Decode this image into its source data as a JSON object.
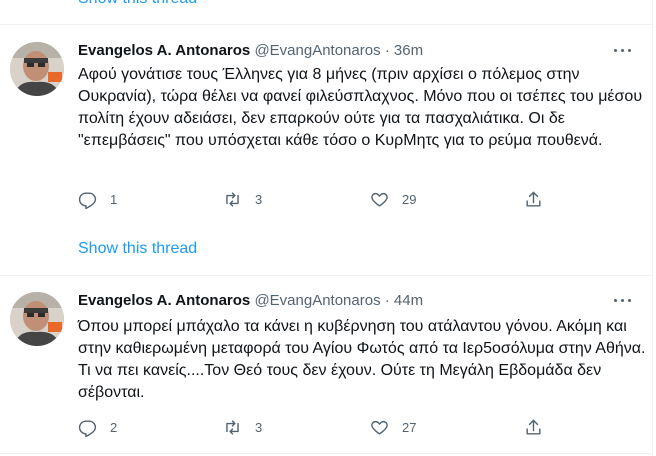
{
  "top_link": "Show this thread",
  "tweets": [
    {
      "name": "Evangelos A. Antonaros",
      "handle": "@EvangAntonaros",
      "sep": "·",
      "time": "36m",
      "text": "Αφού γονάτισε τους Έλληνες για 8 μήνες (πριν αρχίσει ο πόλεμος στην Ουκρανία), τώρα θέλει να φανεί φιλεύσπλαχνος. Μόνο που οι τσέπες του μέσου πολίτη έχουν αδειάσει, δεν επαρκούν ούτε για τα πασχαλιάτικα. Οι δε \"επεμβάσεις\" που υπόσχεται κάθε τόσο ο ΚυρΜητς για το ρεύμα πουθενά.",
      "replies": "1",
      "retweets": "3",
      "likes": "29",
      "show_thread": "Show this thread"
    },
    {
      "name": "Evangelos A. Antonaros",
      "handle": "@EvangAntonaros",
      "sep": "·",
      "time": "44m",
      "text": "Όπου μπορεί μπάχαλο τα κάνει η κυβέρνηση του ατάλαντου γόνου. Ακόμη και στην καθιερωμένη μεταφορά του Αγίου Φωτός από τα Ιερ5οσόλυμα στην Αθήνα. Τι να πει κανείς....Τον Θεό τους δεν έχουν. Ούτε τη Μεγάλη Εβδομάδα δεν σέβονται.",
      "replies": "2",
      "retweets": "3",
      "likes": "27"
    }
  ],
  "icons": {
    "reply": "reply-icon",
    "retweet": "retweet-icon",
    "like": "heart-icon",
    "share": "share-icon",
    "more": "more-icon"
  },
  "colors": {
    "link": "#1d9bf0",
    "secondary": "#536471",
    "text": "#0f1419",
    "divider": "#eff3f4"
  }
}
